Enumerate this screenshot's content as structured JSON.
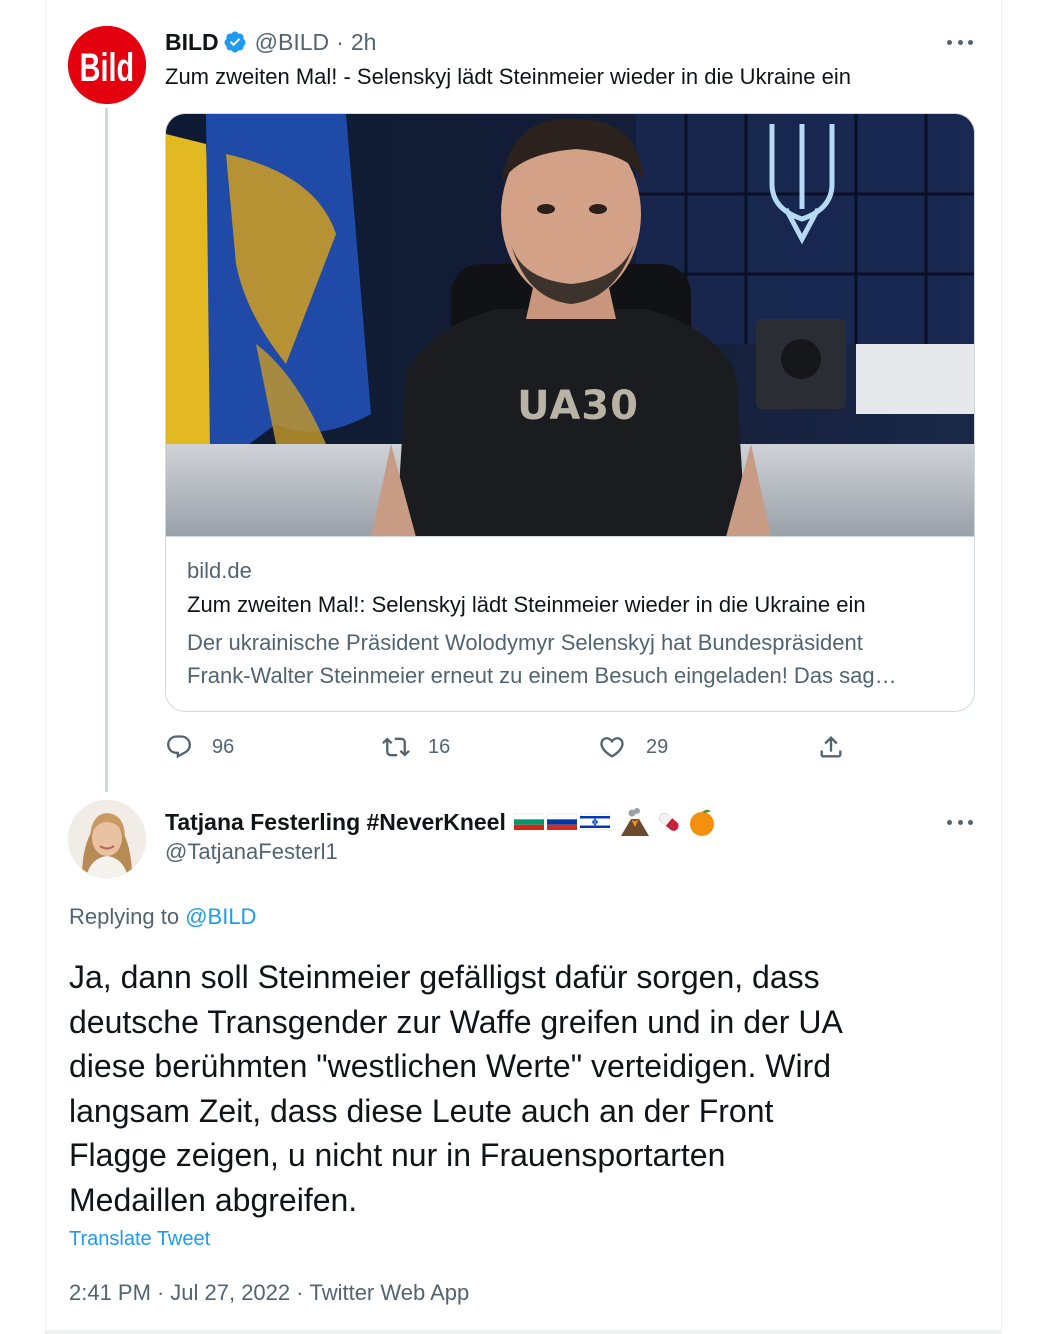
{
  "parent_tweet": {
    "display_name": "BILD",
    "handle": "@BILD",
    "separator": "·",
    "time_ago": "2h",
    "text": "Zum zweiten Mal! - Selenskyj lädt Steinmeier wieder in die Ukraine ein",
    "avatar_logo": "Bild",
    "card": {
      "image_shirt_text": "UA30",
      "domain": "bild.de",
      "title": "Zum zweiten Mal!: Selenskyj lädt Steinmeier wieder in die Ukraine ein",
      "description_lines": [
        "Der ukrainische Präsident Wolodymyr Selenskyj hat Bundespräsident",
        "Frank-Walter Steinmeier erneut zu einem Besuch eingeladen! Das sag…"
      ]
    },
    "actions": {
      "reply_count": "96",
      "retweet_count": "16",
      "like_count": "29"
    }
  },
  "reply_tweet": {
    "display_name": "Tatjana Festerling #NeverKneel",
    "handle": "@TatjanaFesterl1",
    "replying_prefix": "Replying to",
    "replying_to": "@BILD",
    "text_lines": [
      "Ja, dann soll Steinmeier gefälligst dafür sorgen, dass",
      "deutsche Transgender zur Waffe greifen und in der UA",
      "diese berühmten \"westlichen Werte\" verteidigen. Wird",
      "langsam Zeit, dass diese Leute auch an der Front",
      "Flagge zeigen, u nicht nur in Frauensportarten",
      "Medaillen abgreifen."
    ],
    "translate_label": "Translate Tweet",
    "meta": {
      "time": "2:41 PM",
      "separator": "·",
      "date": "Jul 27, 2022",
      "source": "Twitter Web App"
    }
  },
  "icons": {
    "verified": "verified-badge-icon",
    "more": "more-dots-icon",
    "reply": "reply-icon",
    "retweet": "retweet-icon",
    "like": "heart-icon",
    "share": "share-icon",
    "name_emojis": [
      "flag-bulgaria-icon",
      "flag-russia-icon",
      "flag-israel-icon",
      "volcano-icon",
      "pill-icon",
      "tangerine-icon"
    ]
  },
  "colors": {
    "brand_blue": "#1d9bf0",
    "bild_red": "#e3000f",
    "text_primary": "#0f1419",
    "text_secondary": "#536471",
    "border": "#cfd9de"
  }
}
